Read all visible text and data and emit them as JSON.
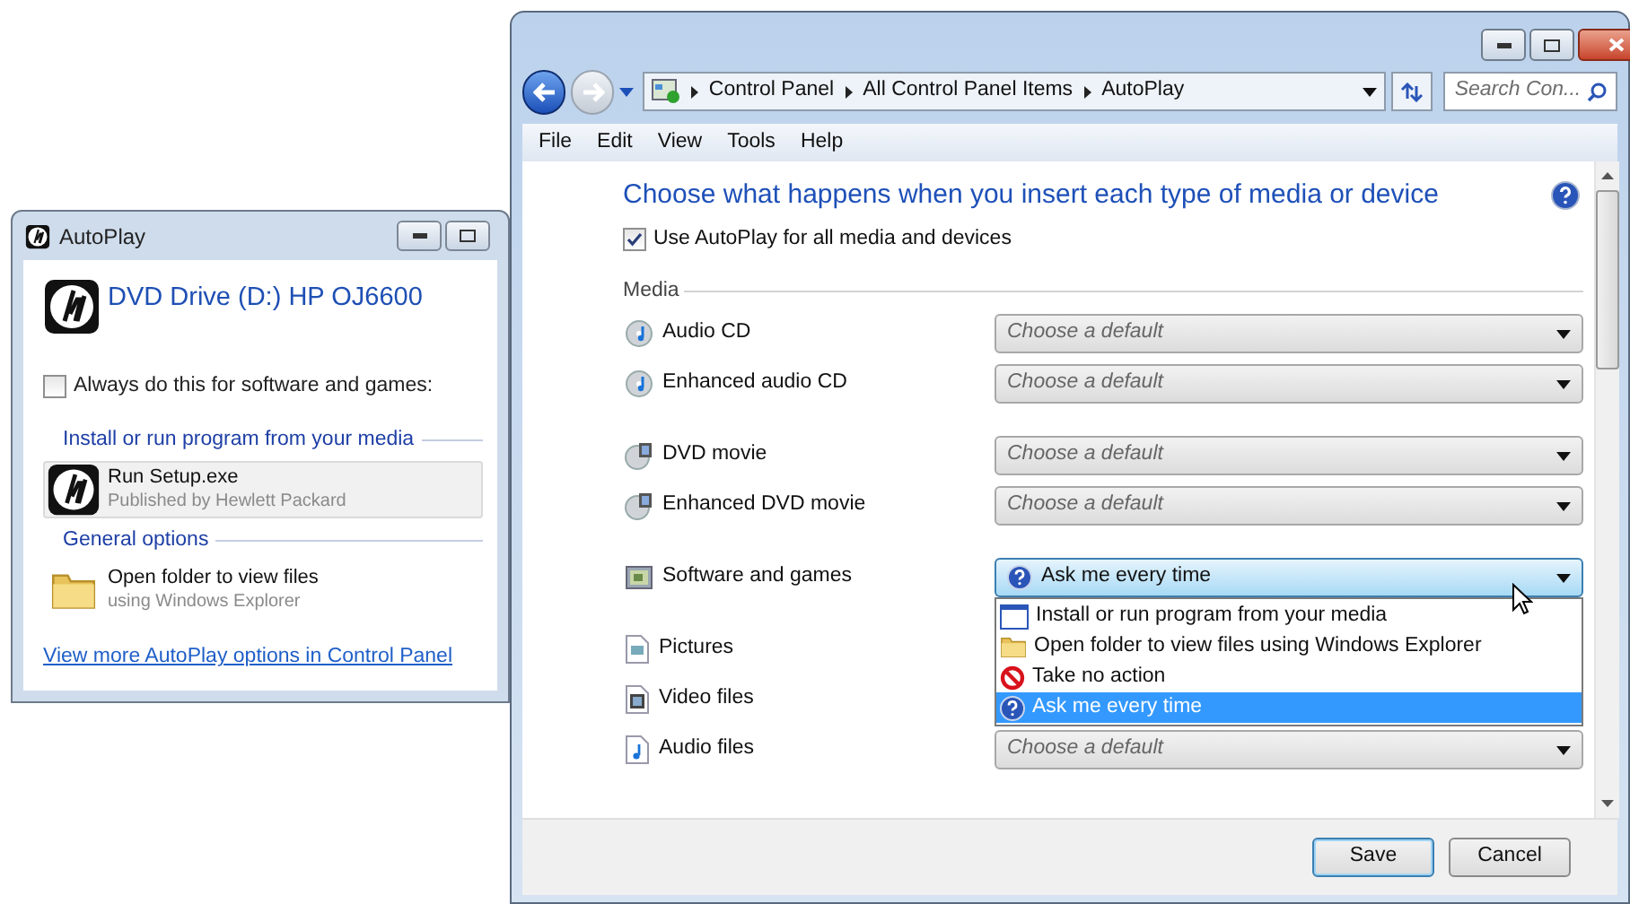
{
  "autoplay_dialog": {
    "title": "AutoPlay",
    "device_title": "DVD Drive (D:) HP OJ6600",
    "always_checkbox": {
      "label": "Always do this for software and games:",
      "checked": false
    },
    "sections": [
      {
        "heading": "Install or run program from your media",
        "items": [
          {
            "kind": "program",
            "title": "Run Setup.exe",
            "subtitle": "Published by Hewlett Packard",
            "selected": true
          }
        ]
      },
      {
        "heading": "General options",
        "items": [
          {
            "kind": "folder",
            "title": "Open folder to view files",
            "subtitle": "using Windows Explorer",
            "selected": false
          }
        ]
      }
    ],
    "link": "View more AutoPlay options in Control Panel"
  },
  "control_panel": {
    "breadcrumbs": [
      "Control Panel",
      "All Control Panel Items",
      "AutoPlay"
    ],
    "search": {
      "placeholder": "Search Con..."
    },
    "menu": [
      "File",
      "Edit",
      "View",
      "Tools",
      "Help"
    ],
    "heading": "Choose what happens when you insert each type of media or device",
    "use_autoplay": {
      "label": "Use AutoPlay for all media and devices",
      "checked": true
    },
    "group_label": "Media",
    "row_groups": [
      [
        {
          "kind": "audio-cd",
          "label": "Audio CD",
          "placeholder": "Choose a default"
        },
        {
          "kind": "audio-cd",
          "label": "Enhanced audio CD",
          "placeholder": "Choose a default"
        }
      ],
      [
        {
          "kind": "dvd",
          "label": "DVD movie",
          "placeholder": "Choose a default"
        },
        {
          "kind": "dvd",
          "label": "Enhanced DVD movie",
          "placeholder": "Choose a default"
        }
      ],
      [
        {
          "kind": "software",
          "label": "Software and games",
          "value": "Ask me every time",
          "expanded": true,
          "options": [
            {
              "kind": "window",
              "label": "Install or run program from your media",
              "selected": false
            },
            {
              "kind": "folder",
              "label": "Open folder to view files using Windows Explorer",
              "selected": false
            },
            {
              "kind": "no",
              "label": "Take no action",
              "selected": false
            },
            {
              "kind": "question",
              "label": "Ask me every time",
              "selected": true
            }
          ]
        }
      ],
      [
        {
          "kind": "pictures",
          "label": "Pictures"
        },
        {
          "kind": "video",
          "label": "Video files"
        },
        {
          "kind": "audio-file",
          "label": "Audio files",
          "placeholder": "Choose a default"
        }
      ]
    ],
    "buttons": [
      {
        "label": "Save",
        "default": true
      },
      {
        "label": "Cancel",
        "default": false
      }
    ]
  }
}
